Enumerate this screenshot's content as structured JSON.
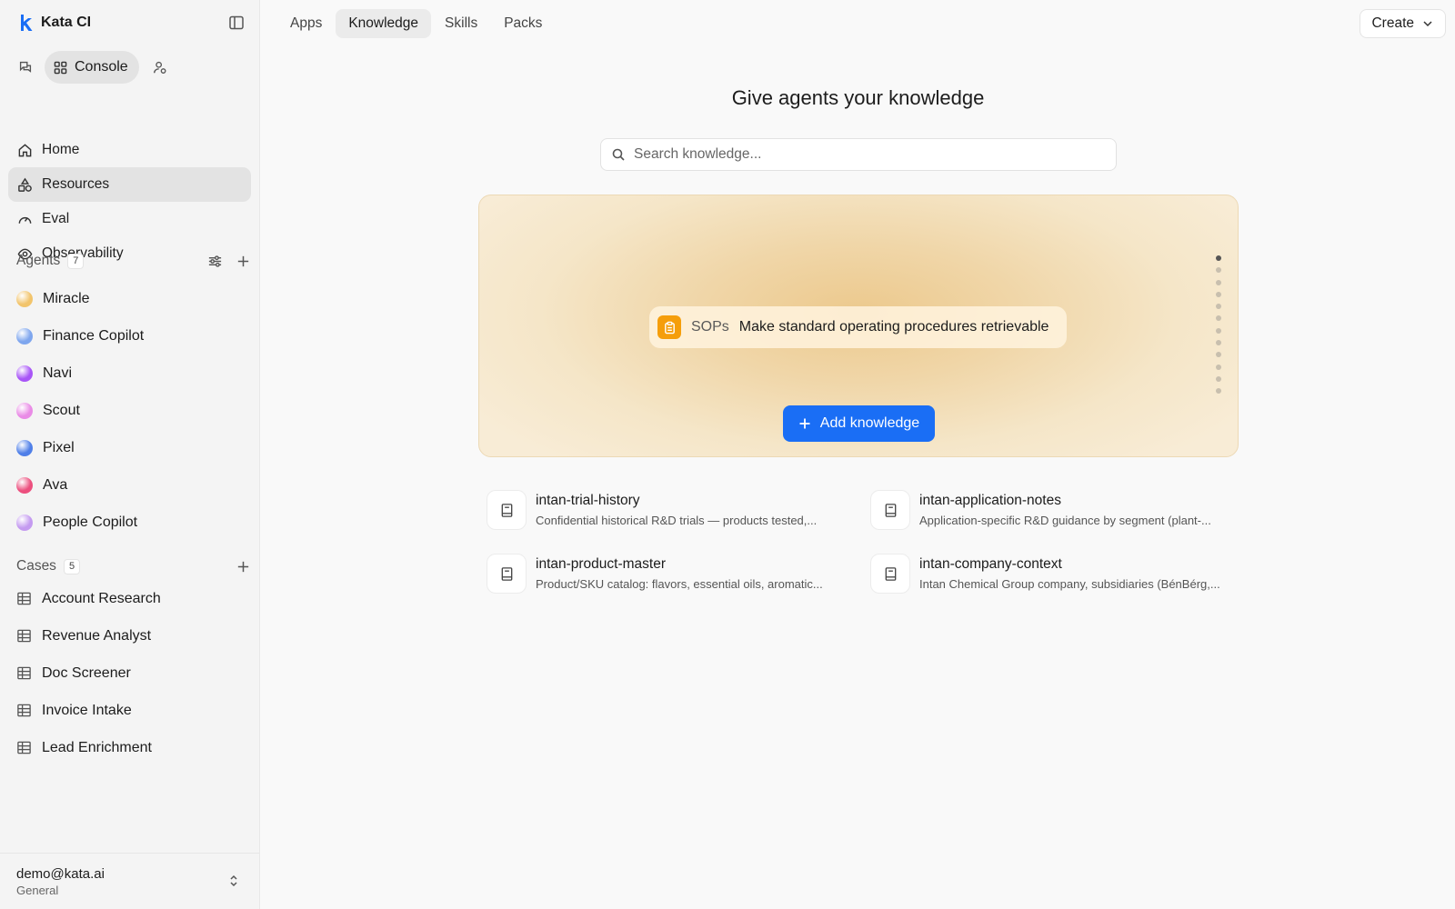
{
  "app": {
    "name": "Kata CI"
  },
  "mode": {
    "console_label": "Console"
  },
  "nav": [
    {
      "label": "Home",
      "icon": "home-icon"
    },
    {
      "label": "Resources",
      "icon": "shapes-icon",
      "active": true
    },
    {
      "label": "Eval",
      "icon": "gauge-icon"
    },
    {
      "label": "Observability",
      "icon": "eye-icon"
    }
  ],
  "agents": {
    "title": "Agents",
    "count": "7",
    "items": [
      {
        "label": "Miracle",
        "color": "#f2c46b"
      },
      {
        "label": "Finance Copilot",
        "color": "#7ea6ee"
      },
      {
        "label": "Navi",
        "color": "#a855f7"
      },
      {
        "label": "Scout",
        "color": "#e98be6"
      },
      {
        "label": "Pixel",
        "color": "#4f7fe8"
      },
      {
        "label": "Ava",
        "color": "#ec4f7e"
      },
      {
        "label": "People Copilot",
        "color": "#c49af0"
      }
    ]
  },
  "cases": {
    "title": "Cases",
    "count": "5",
    "items": [
      {
        "label": "Account Research"
      },
      {
        "label": "Revenue Analyst"
      },
      {
        "label": "Doc Screener"
      },
      {
        "label": "Invoice Intake"
      },
      {
        "label": "Lead Enrichment"
      }
    ]
  },
  "account": {
    "email": "demo@kata.ai",
    "workspace": "General"
  },
  "tabs": [
    {
      "label": "Apps"
    },
    {
      "label": "Knowledge",
      "active": true
    },
    {
      "label": "Skills"
    },
    {
      "label": "Packs"
    }
  ],
  "create_label": "Create",
  "hero": {
    "title": "Give agents your knowledge",
    "search_placeholder": "Search knowledge..."
  },
  "banner": {
    "chip_label": "SOPs",
    "chip_description": "Make standard operating procedures retrievable",
    "add_button": "Add knowledge",
    "carousel_total": 12,
    "carousel_active": 1
  },
  "knowledge": [
    {
      "name": "intan-trial-history",
      "description": "Confidential historical R&D trials — products tested,..."
    },
    {
      "name": "intan-application-notes",
      "description": "Application-specific R&D guidance by segment (plant-..."
    },
    {
      "name": "intan-product-master",
      "description": "Product/SKU catalog: flavors, essential oils, aromatic..."
    },
    {
      "name": "intan-company-context",
      "description": "Intan Chemical Group company, subsidiaries (BénBérg,..."
    }
  ],
  "colors": {
    "accent": "#1a6ef5",
    "sop_icon": "#f59e0b"
  }
}
